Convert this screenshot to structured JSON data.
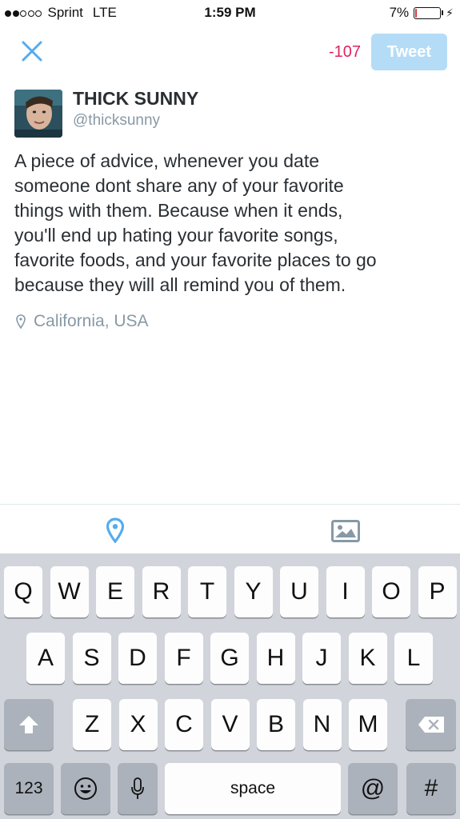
{
  "status_bar": {
    "signal_strength": 2,
    "signal_max": 5,
    "carrier": "Sprint",
    "network": "LTE",
    "time": "1:59 PM",
    "battery_percent": "7%",
    "battery_level": 0.07,
    "low_battery_color": "#e0323c"
  },
  "compose": {
    "close_icon": "close-icon",
    "char_counter": "-107",
    "tweet_button": "Tweet",
    "accent_color": "#55acee"
  },
  "author": {
    "display_name": "THICK SUNNY",
    "handle": "@thicksunny"
  },
  "tweet": {
    "text": "A piece of advice, whenever you date\nsomeone dont share any of your favorite\nthings with them. Because when it ends,\nyou'll end up hating your favorite songs,\nfavorite foods, and your favorite places to go\nbecause they will all remind you of them."
  },
  "location": {
    "icon": "location-pin-icon",
    "label": "California, USA"
  },
  "toolbar": {
    "location_icon": "location-pin-icon",
    "photo_icon": "photo-icon"
  },
  "keyboard": {
    "row1": [
      "Q",
      "W",
      "E",
      "R",
      "T",
      "Y",
      "U",
      "I",
      "O",
      "P"
    ],
    "row2": [
      "A",
      "S",
      "D",
      "F",
      "G",
      "H",
      "J",
      "K",
      "L"
    ],
    "row3": [
      "Z",
      "X",
      "C",
      "V",
      "B",
      "N",
      "M"
    ],
    "numbers_key": "123",
    "space_key": "space",
    "at_key": "@",
    "hash_key": "#"
  }
}
